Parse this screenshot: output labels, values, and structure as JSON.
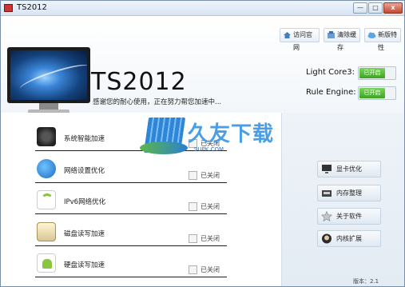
{
  "window": {
    "title": "TS2012"
  },
  "title_buttons": {
    "minimize": "—",
    "maximize": "□",
    "close": "x"
  },
  "toplinks": [
    {
      "label": "访问官网",
      "icon": "home-icon"
    },
    {
      "label": "清除缓存",
      "icon": "broom-icon"
    },
    {
      "label": "新版特性",
      "icon": "cloud-icon"
    }
  ],
  "header": {
    "brand": "TS2012",
    "tagline": "感谢您的耐心使用，正在努力帮您加速中..."
  },
  "toggles": [
    {
      "label": "Light Core3:",
      "state": "已开启"
    },
    {
      "label": "Rule Engine:",
      "state": "已开启"
    }
  ],
  "features": [
    {
      "label": "系统智能加速",
      "status": "已关闭",
      "icon": "gear-icon"
    },
    {
      "label": "网络设置优化",
      "status": "已关闭",
      "icon": "globe-icon"
    },
    {
      "label": "IPv6网络优化",
      "status": "已关闭",
      "icon": "wifi-icon"
    },
    {
      "label": "磁盘读写加速",
      "status": "已关闭",
      "icon": "disk-icon"
    },
    {
      "label": "硬盘读写加速",
      "status": "已关闭",
      "icon": "android-icon"
    }
  ],
  "side_buttons": [
    {
      "label": "显卡优化",
      "icon": "monitor-icon"
    },
    {
      "label": "内存整理",
      "icon": "memory-icon"
    },
    {
      "label": "关于软件",
      "icon": "star-icon"
    },
    {
      "label": "内核扩展",
      "icon": "avatar-icon"
    }
  ],
  "watermark": {
    "text": "久友下载",
    "url": "9UPK.COM"
  },
  "version": "版本：2.1"
}
